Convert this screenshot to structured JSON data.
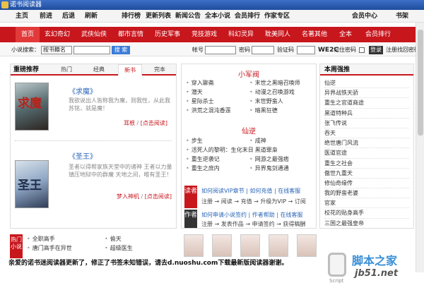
{
  "app_title": "诺书阅读器",
  "topnav": {
    "left": [
      "主页",
      "前进",
      "后退",
      "刷新"
    ],
    "middle": [
      "排行榜",
      "更新列表",
      "新闻公告",
      "全本小说",
      "会员排行",
      "作家专区"
    ],
    "right": [
      "会员中心",
      "书架"
    ]
  },
  "rednav": [
    "首页",
    "玄幻奇幻",
    "武侠仙侠",
    "都市言情",
    "历史军事",
    "竞技游戏",
    "科幻灵异",
    "耽美同人",
    "名著其他",
    "全本",
    "会员排行"
  ],
  "search": {
    "label": "小说搜索：",
    "select": "按书籍名",
    "button": "搜 索",
    "account_label": "帐号",
    "password_label": "密码",
    "code_label": "验证码",
    "code_value": "WE2C",
    "remember_label": "记住密码",
    "login_button": "登录",
    "register": "注册",
    "forgot": "找回密码"
  },
  "left_panel": {
    "title": "重磅推荐",
    "tabs": [
      "热门",
      "经典",
      "新书",
      "完本"
    ],
    "active_tab": "新书",
    "books": [
      {
        "cover_text": "求魔",
        "title": "《求魔》",
        "desc": "我欲说出人皆称我为魔，则我性，从此我苏铭，就是魔！",
        "author": "耳根",
        "link": "[点击阅读]"
      },
      {
        "cover_text": "圣王",
        "title": "《圣王》",
        "desc": "圣者以得帮家族天堂中的诸神 王者以力量镇压地狱中的群魔 天地之间，唯有圣王！",
        "author": "梦入神机",
        "link": "[点击阅读]"
      }
    ]
  },
  "middle_panel": {
    "section1_title": "小军阀",
    "section1_left": [
      "穿入聊斋",
      "潜天",
      "星际杀士",
      "洪荒之混沌香莲"
    ],
    "section1_right": [
      "末世之黑暗召唤师",
      "动漫之召唤游戏",
      "末世野蛮人",
      "暗黑狂德"
    ],
    "section2_title": "仙逆",
    "section2_left": [
      "步生",
      "活死人的黎明：生化末日",
      "重生逆袭记",
      "重生之庶内"
    ],
    "section2_right": [
      "成神",
      "黑道罪枭",
      "网游之最强痞",
      "异界鬼剑通通"
    ],
    "reader_box_label": "读者",
    "reader_row1": [
      "如何阅读VIP章节",
      "如何充值",
      "在线客服"
    ],
    "reader_row2": [
      "注册",
      "阅读",
      "充值",
      "升级为VIP",
      "订阅"
    ],
    "author_box_label": "作者",
    "author_row1": [
      "如何申请小说签约",
      "作者帮助",
      "在线客服"
    ],
    "author_row2": [
      "注册",
      "发表作品",
      "申请签约",
      "获得稿酬"
    ]
  },
  "right_panel": {
    "title": "本周强推",
    "items": [
      "仙逆",
      "异界战铁天骄",
      "重生之官道商途",
      "黑道特种兵",
      "张飞传说",
      "吞天",
      "绝世唐门风流",
      "医道官途",
      "重生之社会",
      "傲世九重天",
      "修仙奇缘传",
      "我的野蛮老婆",
      "官家",
      "校花的贴身高手",
      "三国之最强皇帝"
    ]
  },
  "bottom": {
    "side_label": "热门小说",
    "left_col": [
      "全职高手",
      "唐门高手在异世"
    ],
    "right_col": [
      "偷天",
      "超级医生"
    ],
    "notice": "亲爱的诺书迷阅读器更新了，修正了书签未知错误，请去d.nuoshu.com下载最新版阅读器谢谢。"
  },
  "watermark": {
    "brand": "脚本之家",
    "url": "jb51.net",
    "sub": "Script"
  },
  "colors": {
    "accent": "#c8161d",
    "titlebar": "#2b5cb3",
    "link": "#2a66b8"
  }
}
